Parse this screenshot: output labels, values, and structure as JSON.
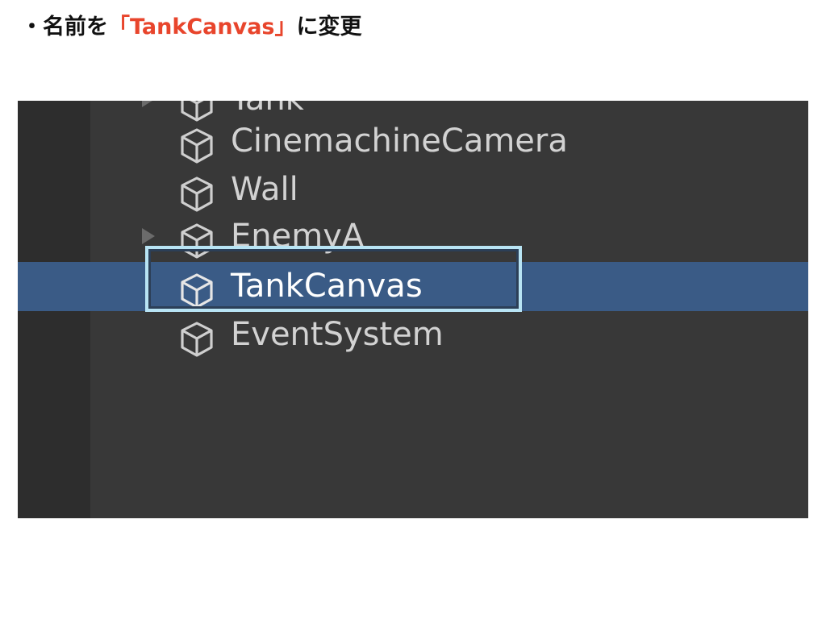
{
  "instruction": {
    "prefix": "・名前を",
    "highlight": "「TankCanvas」",
    "suffix": "に変更"
  },
  "hierarchy": {
    "items": [
      {
        "label": "Tank",
        "expandable": true,
        "selected": false
      },
      {
        "label": "CinemachineCamera",
        "expandable": false,
        "selected": false
      },
      {
        "label": "Wall",
        "expandable": false,
        "selected": false
      },
      {
        "label": "EnemyA",
        "expandable": true,
        "selected": false
      },
      {
        "label": "TankCanvas",
        "expandable": false,
        "selected": true
      },
      {
        "label": "EventSystem",
        "expandable": false,
        "selected": false
      }
    ]
  },
  "colors": {
    "highlight_text": "#e8452c",
    "panel_bg": "#383838",
    "selected_row": "#3a5b86",
    "outline": "#b8e4f4"
  },
  "icons": {
    "item_icon": "gameobject-cube-icon",
    "expand_icon": "expand-arrow-icon"
  }
}
